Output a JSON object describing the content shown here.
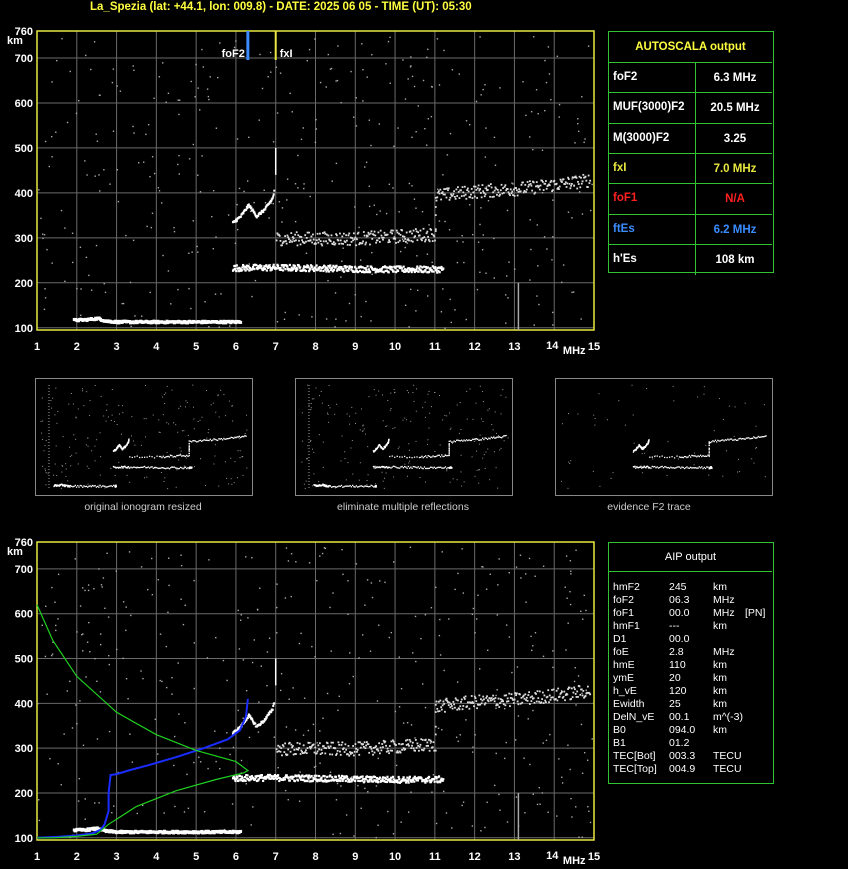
{
  "title": "La_Spezia (lat: +44.1, lon: 009.8) - DATE: 2025 06 05 - TIME (UT): 05:30",
  "colors": {
    "grid": "#6a6a6a",
    "frame": "#e8e840",
    "fof2": "#3a8cff",
    "fxi": "#e8e840",
    "box": "#2fc42f",
    "blue": "#1a2cff",
    "green": "#1fd11f"
  },
  "chart_data": [
    {
      "type": "scatter",
      "title": "",
      "xlabel": "MHz",
      "ylabel": "km",
      "xlim": [
        1,
        15
      ],
      "ylim": [
        95,
        760
      ],
      "xticks": [
        1,
        2,
        3,
        4,
        5,
        6,
        7,
        8,
        9,
        10,
        11,
        12,
        13,
        14,
        15
      ],
      "yticks": [
        100,
        200,
        300,
        400,
        500,
        600,
        700,
        760
      ],
      "markers": [
        {
          "name": "foF2",
          "value": 6.3
        },
        {
          "name": "fxI",
          "value": 7.0
        }
      ],
      "traces": {
        "E_trace": [
          [
            1.9,
            120
          ],
          [
            2.2,
            121
          ],
          [
            2.5,
            124
          ],
          [
            2.7,
            118
          ],
          [
            3.0,
            116
          ],
          [
            4.0,
            116
          ],
          [
            5.0,
            116
          ],
          [
            6.0,
            116
          ],
          [
            6.1,
            117
          ]
        ],
        "F_trace": [
          [
            5.9,
            235
          ],
          [
            6.5,
            236
          ],
          [
            7.0,
            236
          ],
          [
            8.0,
            235
          ],
          [
            9.0,
            233
          ],
          [
            10.0,
            232
          ],
          [
            11.0,
            232
          ],
          [
            11.2,
            233
          ]
        ],
        "F_high": [
          [
            5.9,
            335
          ],
          [
            6.1,
            350
          ],
          [
            6.3,
            375
          ],
          [
            6.5,
            350
          ],
          [
            6.7,
            365
          ],
          [
            6.9,
            390
          ],
          [
            6.95,
            410
          ]
        ],
        "F_mult": [
          [
            7.0,
            300
          ],
          [
            9.0,
            300
          ],
          [
            10.0,
            305
          ],
          [
            11.0,
            310
          ],
          [
            11.0,
            395
          ],
          [
            12.0,
            405
          ],
          [
            13.0,
            410
          ],
          [
            14.0,
            420
          ],
          [
            14.9,
            430
          ]
        ]
      }
    },
    {
      "type": "line",
      "title": "",
      "xlabel": "MHz",
      "ylabel": "km",
      "xlim": [
        1,
        15
      ],
      "ylim": [
        95,
        760
      ],
      "xticks": [
        1,
        2,
        3,
        4,
        5,
        6,
        7,
        8,
        9,
        10,
        11,
        12,
        13,
        14,
        15
      ],
      "yticks": [
        100,
        200,
        300,
        400,
        500,
        600,
        700,
        760
      ],
      "series": [
        {
          "values_x": [
            1.0,
            1.5,
            2.0,
            2.4,
            2.6,
            2.7,
            2.8,
            2.8,
            2.85,
            3.0,
            3.3,
            3.8,
            4.5,
            5.2,
            5.8,
            6.1,
            6.25,
            6.3
          ],
          "values_y": [
            100,
            102,
            105,
            110,
            118,
            130,
            160,
            200,
            240,
            242,
            250,
            262,
            280,
            300,
            320,
            340,
            370,
            410
          ]
        },
        {
          "values_x": [
            1.0,
            1.4,
            2.0,
            2.5,
            2.8,
            3.5,
            4.5,
            5.5,
            6.2,
            6.3,
            6.0,
            5.0,
            4.0,
            3.0,
            2.0,
            1.4,
            1.0
          ],
          "values_y": [
            100,
            100,
            103,
            108,
            130,
            170,
            205,
            230,
            245,
            250,
            270,
            295,
            330,
            380,
            460,
            540,
            620
          ]
        }
      ]
    }
  ],
  "autoscala": {
    "header": "AUTOSCALA output",
    "rows": [
      {
        "key": "foF2",
        "value": "6.3 MHz",
        "color": "#ffffff",
        "vcolor": "#ffffff"
      },
      {
        "key": "MUF(3000)F2",
        "value": "20.5 MHz",
        "color": "#ffffff",
        "vcolor": "#ffffff"
      },
      {
        "key": "M(3000)F2",
        "value": "3.25",
        "color": "#ffffff",
        "vcolor": "#ffffff"
      },
      {
        "key": "fxI",
        "value": "7.0 MHz",
        "color": "#e8e840",
        "vcolor": "#e8e840"
      },
      {
        "key": "foF1",
        "value": "N/A",
        "color": "#ff2020",
        "vcolor": "#ff2020"
      },
      {
        "key": "ftEs",
        "value": "6.2 MHz",
        "color": "#3a8cff",
        "vcolor": "#3a8cff"
      },
      {
        "key": "h'Es",
        "value": "108    km",
        "color": "#ffffff",
        "vcolor": "#ffffff"
      }
    ]
  },
  "thumbnails": [
    {
      "caption": "original ionogram resized"
    },
    {
      "caption": "eliminate multiple reflections"
    },
    {
      "caption": "evidence F2 trace"
    }
  ],
  "aip": {
    "header": "AIP output",
    "rows": [
      {
        "k": "hmF2",
        "v": "245",
        "u": "km",
        "x": ""
      },
      {
        "k": "foF2",
        "v": "06.3",
        "u": "MHz",
        "x": ""
      },
      {
        "k": "foF1",
        "v": "00.0",
        "u": "MHz",
        "x": "[PN]"
      },
      {
        "k": "hmF1",
        "v": "---",
        "u": "km",
        "x": ""
      },
      {
        "k": "D1",
        "v": "00.0",
        "u": "",
        "x": ""
      },
      {
        "k": "foE",
        "v": "2.8",
        "u": "MHz",
        "x": ""
      },
      {
        "k": "hmE",
        "v": "110",
        "u": "km",
        "x": ""
      },
      {
        "k": "ymE",
        "v": "20",
        "u": "km",
        "x": ""
      },
      {
        "k": "h_vE",
        "v": "120",
        "u": "km",
        "x": ""
      },
      {
        "k": "Ewidth",
        "v": "25",
        "u": "km",
        "x": ""
      },
      {
        "k": "DelN_vE",
        "v": "00.1",
        "u": "m^(-3)",
        "x": ""
      },
      {
        "k": "B0",
        "v": "094.0",
        "u": "km",
        "x": ""
      },
      {
        "k": "B1",
        "v": "01.2",
        "u": "",
        "x": ""
      },
      {
        "k": "TEC[Bot]",
        "v": "003.3",
        "u": "TECU",
        "x": ""
      },
      {
        "k": "TEC[Top]",
        "v": "004.9",
        "u": "TECU",
        "x": ""
      }
    ]
  },
  "marker_labels": {
    "fof2": "foF2",
    "fxi": "fxI"
  }
}
